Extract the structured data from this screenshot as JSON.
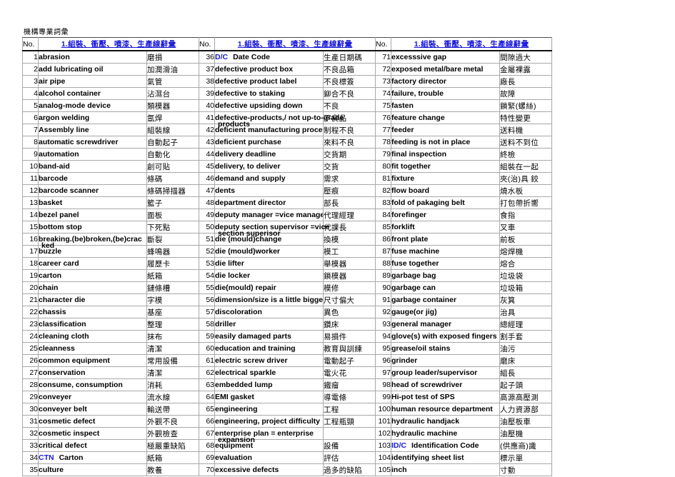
{
  "document": {
    "title": "機構專業詞彙"
  },
  "table": {
    "header": {
      "no_label": "No.",
      "title_label": "1.組裝、衝壓、噴漆、生產線辭彙",
      "title_color": "#1818d8"
    },
    "columns": [
      {
        "rows": [
          {
            "no": "1",
            "en": "abrasion",
            "zh": "磨損"
          },
          {
            "no": "2",
            "en": "add lubricating oil",
            "zh": "加潤滑油"
          },
          {
            "no": "3",
            "en": "air pipe",
            "zh": "氣管"
          },
          {
            "no": "4",
            "en": "alcohol container",
            "zh": "沾濕台"
          },
          {
            "no": "5",
            "en": "analog-mode device",
            "zh": "類模器"
          },
          {
            "no": "6",
            "en": "argon welding",
            "zh": "氬焊"
          },
          {
            "no": "7",
            "en": "Assembly line",
            "zh": "組裝線"
          },
          {
            "no": "8",
            "en": "automatic screwdriver",
            "zh": "自動起子"
          },
          {
            "no": "9",
            "en": "automation",
            "zh": "自動化"
          },
          {
            "no": "10",
            "en": "band-aid",
            "zh": "創可貼"
          },
          {
            "no": "11",
            "en": "barcode",
            "zh": "條碼"
          },
          {
            "no": "12",
            "en": "barcode scanner",
            "zh": "條碼掃描器"
          },
          {
            "no": "13",
            "en": "basket",
            "zh": "籃子"
          },
          {
            "no": "14",
            "en": "bezel panel",
            "zh": "面板"
          },
          {
            "no": "15",
            "en": "bottom stop",
            "zh": "下死點"
          },
          {
            "no": "16",
            "en": "breaking.(be)broken,(be)crac",
            "en2": "ked",
            "zh": "斷裂"
          },
          {
            "no": "17",
            "en": "buzzle",
            "zh": "蜂鳴器"
          },
          {
            "no": "18",
            "en": "career card",
            "zh": "履歷卡"
          },
          {
            "no": "19",
            "en": "carton",
            "zh": "紙箱"
          },
          {
            "no": "20",
            "en": "chain",
            "zh": "鏈條槽"
          },
          {
            "no": "21",
            "en": "character die",
            "zh": "字模"
          },
          {
            "no": "22",
            "en": "chassis",
            "zh": "基座"
          },
          {
            "no": "23",
            "en": "classification",
            "zh": "整理"
          },
          {
            "no": "24",
            "en": "cleaning cloth",
            "zh": "抹布"
          },
          {
            "no": "25",
            "en": "cleanness",
            "zh": "清潔"
          },
          {
            "no": "26",
            "en": "common equipment",
            "zh": "常用設備"
          },
          {
            "no": "27",
            "en": "conservation",
            "zh": "清潔"
          },
          {
            "no": "28",
            "en": "consume, consumption",
            "zh": "消耗"
          },
          {
            "no": "29",
            "en": "conveyer",
            "zh": "流水線"
          },
          {
            "no": "30",
            "en": "conveyer belt",
            "zh": "輸送帶"
          },
          {
            "no": "31",
            "en": "cosmetic defect",
            "zh": "外觀不良"
          },
          {
            "no": "32",
            "en": "cosmetic inspect",
            "zh": "外觀檢查"
          },
          {
            "no": "33",
            "en": "critical defect",
            "zh": "極嚴重缺陷"
          },
          {
            "no": "34",
            "code": "CTN",
            "en": "Carton",
            "zh": "紙箱"
          },
          {
            "no": "35",
            "en": "culture",
            "zh": "教養"
          }
        ]
      },
      {
        "rows": [
          {
            "no": "36",
            "code": "D/C",
            "en": "Date Code",
            "zh": "生產日期碼"
          },
          {
            "no": "37",
            "en": "defective product box",
            "zh": "不良品箱"
          },
          {
            "no": "38",
            "en": "defective product label",
            "zh": "不良標簽"
          },
          {
            "no": "39",
            "en": "defective to staking",
            "zh": "鉚合不良"
          },
          {
            "no": "40",
            "en": "defective upsiding down",
            "zh": "不良"
          },
          {
            "no": "41",
            "en": "defective-products,/ not up-to-grade",
            "en2": "products",
            "zh": "不良品"
          },
          {
            "no": "42",
            "en": "deficient manufacturing procedure",
            "zh": "制程不良"
          },
          {
            "no": "43",
            "en": "deficient purchase",
            "zh": "來料不良"
          },
          {
            "no": "44",
            "en": "delivery deadline",
            "zh": "交貨期"
          },
          {
            "no": "45",
            "en": "delivery, to deliver",
            "zh": "交貨"
          },
          {
            "no": "46",
            "en": "demand and supply",
            "zh": "需求"
          },
          {
            "no": "47",
            "en": "dents",
            "zh": "壓痕"
          },
          {
            "no": "48",
            "en": "department director",
            "zh": "部長"
          },
          {
            "no": "49",
            "en": "deputy manager  =vice manager",
            "zh": "代理經理"
          },
          {
            "no": "50",
            "en": "deputy section supervisor =vice",
            "en2": "section superisor",
            "zh": "代課長"
          },
          {
            "no": "51",
            "en": "die (mould)change",
            "zh": "換模"
          },
          {
            "no": "52",
            "en": "die (mould)worker",
            "zh": "模工"
          },
          {
            "no": "53",
            "en": "die lifter",
            "zh": "舉模器"
          },
          {
            "no": "54",
            "en": "die locker",
            "zh": "鎖模器"
          },
          {
            "no": "55",
            "en": "die(mould) repair",
            "zh": "模修"
          },
          {
            "no": "56",
            "en": "dimension/size is a little bigger",
            "zh": "尺寸偏大"
          },
          {
            "no": "57",
            "en": "discoloration",
            "zh": "異色"
          },
          {
            "no": "58",
            "en": "driller",
            "zh": "鑽床"
          },
          {
            "no": "59",
            "en": "easily damaged parts",
            "zh": "易損件"
          },
          {
            "no": "60",
            "en": "education and training",
            "zh": "教育與訓練"
          },
          {
            "no": "61",
            "en": "electric screw driver",
            "zh": "電動起子"
          },
          {
            "no": "62",
            "en": "electrical sparkle",
            "zh": "電火花"
          },
          {
            "no": "63",
            "en": "embedded lump",
            "zh": "鐵瘤"
          },
          {
            "no": "64",
            "en": "EMI gasket",
            "zh": "導電條"
          },
          {
            "no": "65",
            "en": "engineering",
            "zh": "工程"
          },
          {
            "no": "66",
            "en": "engineering, project difficulty",
            "zh": "工程瓶頸"
          },
          {
            "no": "67",
            "en": "enterprise plan = enterprise",
            "en2": "expansion",
            "zh": ""
          },
          {
            "no": "68",
            "en": "equipment",
            "zh": "設備"
          },
          {
            "no": "69",
            "en": "evaluation",
            "zh": "評估"
          },
          {
            "no": "70",
            "en": "excessive defects",
            "zh": "過多的缺陷"
          }
        ]
      },
      {
        "rows": [
          {
            "no": "71",
            "en": "excesssive gap",
            "zh": "間隙過大"
          },
          {
            "no": "72",
            "en": "exposed metal/bare metal",
            "zh": "金屬裸露"
          },
          {
            "no": "73",
            "en": "factory director",
            "zh": "廠長"
          },
          {
            "no": "74",
            "en": "failure, trouble",
            "zh": "故障"
          },
          {
            "no": "75",
            "en": "fasten",
            "zh": "鎖緊(螺絲)"
          },
          {
            "no": "76",
            "en": "feature change",
            "zh": "特性變更"
          },
          {
            "no": "77",
            "en": "feeder",
            "zh": "送料機"
          },
          {
            "no": "78",
            "en": "feeding is not in place",
            "zh": "送料不到位"
          },
          {
            "no": "79",
            "en": "final inspection",
            "zh": "終檢"
          },
          {
            "no": "80",
            "en": "fit together",
            "zh": "組裝在一起"
          },
          {
            "no": "81",
            "en": "fixture",
            "zh": "夾(治)具 鉸"
          },
          {
            "no": "82",
            "en": "flow board",
            "zh": "燒水板"
          },
          {
            "no": "83",
            "en": "fold of pakaging belt",
            "zh": "打包帶折嚮"
          },
          {
            "no": "84",
            "en": "forefinger",
            "zh": "食指"
          },
          {
            "no": "85",
            "en": "forklift",
            "zh": "叉車"
          },
          {
            "no": "86",
            "en": "front plate",
            "zh": "前板"
          },
          {
            "no": "87",
            "en": "fuse machine",
            "zh": "熔焊機"
          },
          {
            "no": "88",
            "en": "fuse together",
            "zh": "熔合"
          },
          {
            "no": "89",
            "en": "garbage bag",
            "zh": "垃圾袋"
          },
          {
            "no": "90",
            "en": "garbage can",
            "zh": "垃圾箱"
          },
          {
            "no": "91",
            "en": "garbage container",
            "zh": "灰箕"
          },
          {
            "no": "92",
            "en": "gauge(or jig)",
            "zh": "治具"
          },
          {
            "no": "93",
            "en": "general manager",
            "zh": "總經理"
          },
          {
            "no": "94",
            "en": "glove(s) with exposed fingers",
            "zh": "割手套"
          },
          {
            "no": "95",
            "en": "grease/oil stains",
            "zh": "油污"
          },
          {
            "no": "96",
            "en": "grinder",
            "zh": "磨床"
          },
          {
            "no": "97",
            "en": "group leader/supervisor",
            "zh": "組長"
          },
          {
            "no": "98",
            "en": "head of screwdriver",
            "zh": "起子頭"
          },
          {
            "no": "99",
            "en": "Hi-pot test of SPS",
            "zh": "高源高壓測"
          },
          {
            "no": "100",
            "en": "human resource department",
            "zh": "人力資源部"
          },
          {
            "no": "101",
            "en": "hydraulic handjack",
            "zh": "油壓板車"
          },
          {
            "no": "102",
            "en": "hydraulic machine",
            "zh": "油壓機"
          },
          {
            "no": "103",
            "code": "ID/C",
            "en": "Identification Code",
            "zh": "(供應商)識"
          },
          {
            "no": "104",
            "en": "identifying sheet list",
            "zh": "標示單"
          },
          {
            "no": "105",
            "en": "inch",
            "zh": "寸動"
          }
        ]
      }
    ]
  }
}
